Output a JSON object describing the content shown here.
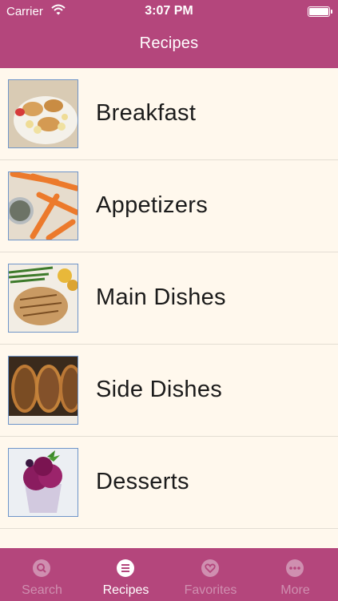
{
  "status_bar": {
    "carrier": "Carrier",
    "time": "3:07 PM"
  },
  "nav": {
    "title": "Recipes"
  },
  "categories": [
    {
      "label": "Breakfast",
      "image": "pancakes-with-bananas-and-strawberries"
    },
    {
      "label": "Appetizers",
      "image": "carrot-sticks-with-dip"
    },
    {
      "label": "Main Dishes",
      "image": "grilled-pork-chop-with-green-beans"
    },
    {
      "label": "Side Dishes",
      "image": "roasted-eggplant-slices"
    },
    {
      "label": "Desserts",
      "image": "berry-sorbet-with-mint"
    }
  ],
  "tabbar": {
    "tabs": [
      {
        "label": "Search",
        "icon": "search-icon",
        "active": false
      },
      {
        "label": "Recipes",
        "icon": "list-icon",
        "active": true
      },
      {
        "label": "Favorites",
        "icon": "heart-icon",
        "active": false
      },
      {
        "label": "More",
        "icon": "more-icon",
        "active": false
      }
    ]
  },
  "colors": {
    "brand": "#b4467c",
    "list_background": "#fff8ed",
    "tab_inactive": "#cf8fb0",
    "tab_active": "#ffffff"
  }
}
